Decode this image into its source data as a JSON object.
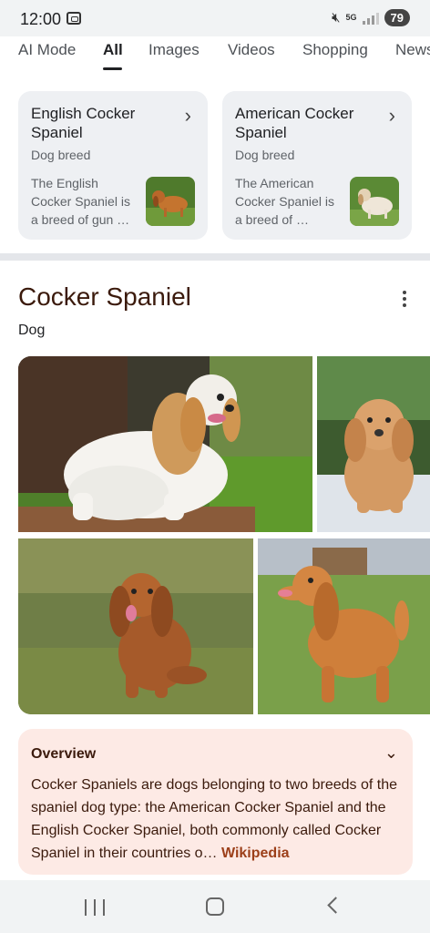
{
  "status": {
    "time": "12:00",
    "network": "5G",
    "battery": "79"
  },
  "tabs": [
    {
      "label": "AI Mode"
    },
    {
      "label": "All"
    },
    {
      "label": "Images"
    },
    {
      "label": "Videos"
    },
    {
      "label": "Shopping"
    },
    {
      "label": "News"
    }
  ],
  "active_tab": "All",
  "cards": [
    {
      "title": "English Cocker Spaniel",
      "subtitle": "Dog breed",
      "description": "The English Cocker Spaniel is a breed of gun …"
    },
    {
      "title": "American Cocker Spaniel",
      "subtitle": "Dog breed",
      "description": "The American Cocker Spaniel is a breed of …"
    }
  ],
  "knowledge_panel": {
    "title": "Cocker Spaniel",
    "subtitle": "Dog"
  },
  "overview": {
    "title": "Overview",
    "text": "Cocker Spaniels are dogs belonging to two breeds of the spaniel dog type: the American Cocker Spaniel and the English Cocker Spaniel, both commonly called Cocker Spaniel in their countries o… ",
    "link": "Wikipedia"
  },
  "colors": {
    "accent_text": "#3b1a0c",
    "link": "#9c3f19",
    "overview_bg": "#fdeae5"
  },
  "icons": {
    "status_left": "screen-record-icon",
    "mute": "mute-icon",
    "signal": "signal-icon",
    "card_chevron": "chevron-right-icon",
    "menu": "more-vert-icon",
    "overview_toggle": "chevron-down-icon",
    "nav_recent": "recent-apps-icon",
    "nav_home": "home-icon",
    "nav_back": "back-icon"
  }
}
